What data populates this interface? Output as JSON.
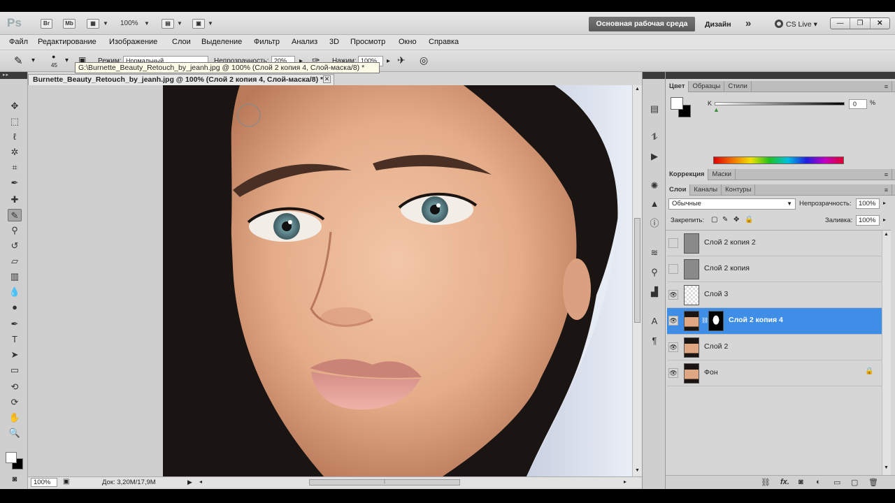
{
  "app": {
    "logo": "Ps",
    "bridge": "Br",
    "minibridge": "Mb",
    "zoom": "100%",
    "workspace_active": "Основная рабочая среда",
    "workspace_other": "Дизайн",
    "more": "»",
    "cs_live": "CS Live"
  },
  "menu": [
    "Файл",
    "Редактирование",
    "Изображение",
    "Слои",
    "Выделение",
    "Фильтр",
    "Анализ",
    "3D",
    "Просмотр",
    "Окно",
    "Справка"
  ],
  "options": {
    "brush_size": "45",
    "mode_label": "Режим:",
    "mode_value": "Нормальный",
    "opacity_label": "Непрозрачность:",
    "opacity_value": "20%",
    "flow_label": "Нажим:",
    "flow_value": "100%"
  },
  "tooltip": "G:\\Burnette_Beauty_Retouch_by_jeanh.jpg @ 100% (Слой 2 копия 4, Слой-маска/8) *",
  "document": {
    "tab_title": "Burnette_Beauty_Retouch_by_jeanh.jpg @ 100% (Слой 2 копия 4, Слой-маска/8) *",
    "zoom": "100%",
    "doc_info": "Док: 3,20M/17,9M"
  },
  "color_panel": {
    "tabs": [
      "Цвет",
      "Образцы",
      "Стили"
    ],
    "channel": "K",
    "value": "0",
    "unit": "%"
  },
  "adjust_panel": {
    "tabs": [
      "Коррекция",
      "Маски"
    ]
  },
  "layers_panel": {
    "tabs": [
      "Слои",
      "Каналы",
      "Контуры"
    ],
    "blend_mode": "Обычные",
    "opacity_label": "Непрозрачность:",
    "opacity_value": "100%",
    "lock_label": "Закрепить:",
    "fill_label": "Заливка:",
    "fill_value": "100%",
    "layers": [
      {
        "name": "Слой 2 копия 2",
        "visible": false,
        "selected": false
      },
      {
        "name": "Слой 2 копия",
        "visible": false,
        "selected": false
      },
      {
        "name": "Слой 3",
        "visible": true,
        "selected": false
      },
      {
        "name": "Слой 2 копия 4",
        "visible": true,
        "selected": true
      },
      {
        "name": "Слой 2",
        "visible": true,
        "selected": false
      },
      {
        "name": "Фон",
        "visible": true,
        "selected": false
      }
    ]
  }
}
